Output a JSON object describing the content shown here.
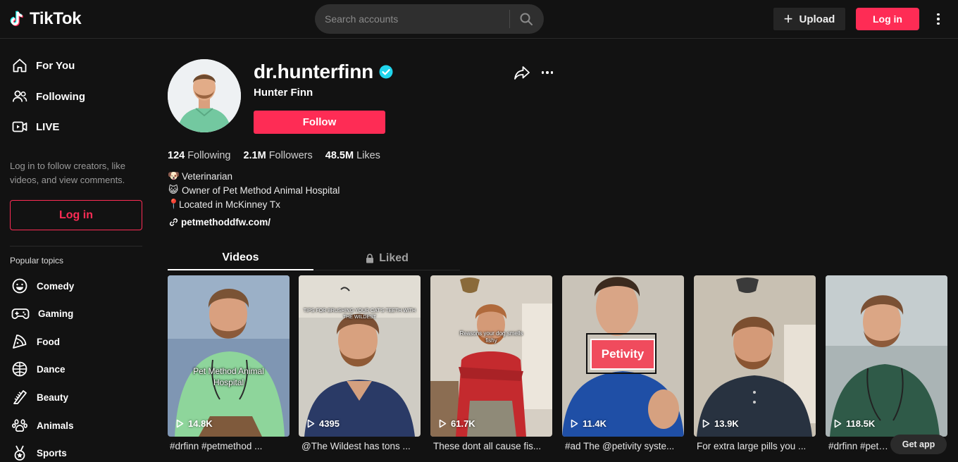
{
  "header": {
    "logo_text": "TikTok",
    "search_placeholder": "Search accounts",
    "upload_label": "Upload",
    "login_label": "Log in",
    "accent_color": "#fe2c55"
  },
  "sidebar": {
    "nav": [
      {
        "label": "For You",
        "icon": "home-icon"
      },
      {
        "label": "Following",
        "icon": "following-icon"
      },
      {
        "label": "LIVE",
        "icon": "live-icon"
      }
    ],
    "note": "Log in to follow creators, like videos, and view comments.",
    "login_label": "Log in",
    "popular_title": "Popular topics",
    "topics": [
      {
        "label": "Comedy",
        "icon": "comedy-icon"
      },
      {
        "label": "Gaming",
        "icon": "gaming-icon"
      },
      {
        "label": "Food",
        "icon": "food-icon"
      },
      {
        "label": "Dance",
        "icon": "dance-icon"
      },
      {
        "label": "Beauty",
        "icon": "beauty-icon"
      },
      {
        "label": "Animals",
        "icon": "animals-icon"
      },
      {
        "label": "Sports",
        "icon": "sports-icon"
      }
    ]
  },
  "profile": {
    "username": "dr.hunterfinn",
    "nickname": "Hunter Finn",
    "follow_label": "Follow",
    "stats": {
      "following_count": "124",
      "following_label": "Following",
      "followers_count": "2.1M",
      "followers_label": "Followers",
      "likes_count": "48.5M",
      "likes_label": "Likes"
    },
    "bio": [
      {
        "emoji": "🐶",
        "text": "Veterinarian"
      },
      {
        "emoji": "😺",
        "text": " Owner of Pet Method Animal Hospital"
      },
      {
        "emoji": "📍",
        "text": "Located in McKinney Tx"
      }
    ],
    "link": "petmethoddfw.com/"
  },
  "tabs": {
    "videos": "Videos",
    "liked": "Liked"
  },
  "videos": [
    {
      "views": "14.8K",
      "caption": "#drfinn #petmethod ...",
      "overlay": "Pet Method Animal Hospital"
    },
    {
      "views": "4395",
      "caption": "@The Wildest has tons ...",
      "overlay": "TIPS FOR BRUSHING YOUR CAT'S TEETH WITH THE WILDEST"
    },
    {
      "views": "61.7K",
      "caption": "These dont all cause fis...",
      "overlay": "Reasons your dog smells fishy"
    },
    {
      "views": "11.4K",
      "caption": "#ad The @petivity syste...",
      "overlay": "Petivity"
    },
    {
      "views": "13.9K",
      "caption": "For extra large pills you ...",
      "overlay": ""
    },
    {
      "views": "118.5K",
      "caption": "#drfinn #petm...",
      "overlay": ""
    }
  ],
  "get_app": "Get app"
}
